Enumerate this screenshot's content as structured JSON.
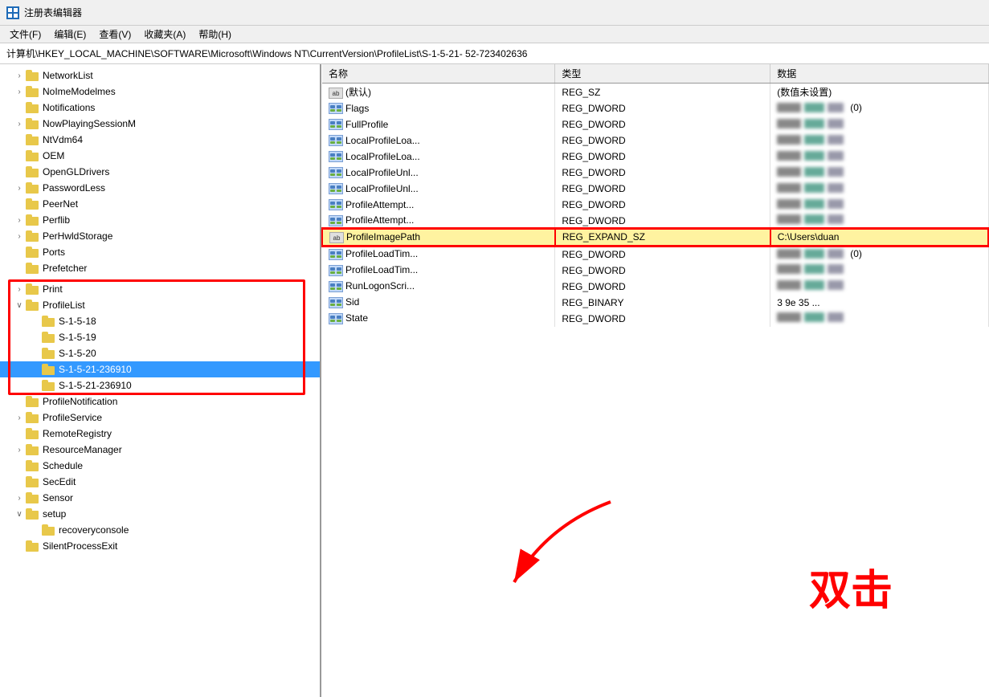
{
  "titlebar": {
    "icon": "🖥",
    "title": "注册表编辑器"
  },
  "menubar": {
    "items": [
      "文件(F)",
      "编辑(E)",
      "查看(V)",
      "收藏夹(A)",
      "帮助(H)"
    ]
  },
  "addressbar": {
    "path": "计算机\\HKEY_LOCAL_MACHINE\\SOFTWARE\\Microsoft\\Windows NT\\CurrentVersion\\ProfileList\\S-1-5-21-                52-723402636"
  },
  "tree": {
    "items": [
      {
        "label": "NetworkList",
        "indent": 1,
        "arrow": "›",
        "selected": false
      },
      {
        "label": "NoImeModelmes",
        "indent": 1,
        "arrow": "›",
        "selected": false
      },
      {
        "label": "Notifications",
        "indent": 1,
        "arrow": "",
        "selected": false
      },
      {
        "label": "NowPlayingSessionM",
        "indent": 1,
        "arrow": "›",
        "selected": false
      },
      {
        "label": "NtVdm64",
        "indent": 1,
        "arrow": "",
        "selected": false
      },
      {
        "label": "OEM",
        "indent": 1,
        "arrow": "",
        "selected": false
      },
      {
        "label": "OpenGLDrivers",
        "indent": 1,
        "arrow": "",
        "selected": false
      },
      {
        "label": "PasswordLess",
        "indent": 1,
        "arrow": "›",
        "selected": false
      },
      {
        "label": "PeerNet",
        "indent": 1,
        "arrow": "",
        "selected": false
      },
      {
        "label": "Perflib",
        "indent": 1,
        "arrow": "›",
        "selected": false
      },
      {
        "label": "PerHwldStorage",
        "indent": 1,
        "arrow": "›",
        "selected": false
      },
      {
        "label": "Ports",
        "indent": 1,
        "arrow": "",
        "selected": false
      },
      {
        "label": "Prefetcher",
        "indent": 1,
        "arrow": "",
        "selected": false
      },
      {
        "label": "Print",
        "indent": 1,
        "arrow": "›",
        "selected": false,
        "extra_space": true
      },
      {
        "label": "ProfileList",
        "indent": 1,
        "arrow": "∨",
        "selected": false,
        "highlighted": true
      },
      {
        "label": "S-1-5-18",
        "indent": 2,
        "arrow": "",
        "selected": false
      },
      {
        "label": "S-1-5-19",
        "indent": 2,
        "arrow": "",
        "selected": false
      },
      {
        "label": "S-1-5-20",
        "indent": 2,
        "arrow": "",
        "selected": false
      },
      {
        "label": "S-1-5-21-236910",
        "indent": 2,
        "arrow": "",
        "selected": true
      },
      {
        "label": "S-1-5-21-236910",
        "indent": 2,
        "arrow": "",
        "selected": false
      },
      {
        "label": "ProfileNotification",
        "indent": 1,
        "arrow": "",
        "selected": false
      },
      {
        "label": "ProfileService",
        "indent": 1,
        "arrow": "›",
        "selected": false
      },
      {
        "label": "RemoteRegistry",
        "indent": 1,
        "arrow": "",
        "selected": false
      },
      {
        "label": "ResourceManager",
        "indent": 1,
        "arrow": "›",
        "selected": false
      },
      {
        "label": "Schedule",
        "indent": 1,
        "arrow": "",
        "selected": false
      },
      {
        "label": "SecEdit",
        "indent": 1,
        "arrow": "",
        "selected": false
      },
      {
        "label": "Sensor",
        "indent": 1,
        "arrow": "›",
        "selected": false
      },
      {
        "label": "setup",
        "indent": 1,
        "arrow": "∨",
        "selected": false
      },
      {
        "label": "recoveryconsole",
        "indent": 2,
        "arrow": "",
        "selected": false
      },
      {
        "label": "SilentProcessExit",
        "indent": 1,
        "arrow": "",
        "selected": false
      }
    ]
  },
  "values": {
    "columns": [
      "名称",
      "类型",
      "数据"
    ],
    "rows": [
      {
        "name": "(默认)",
        "type_ab": true,
        "type": "REG_SZ",
        "data": "(数值未设置)",
        "blurred": false
      },
      {
        "name": "Flags",
        "type_ab": false,
        "type": "REG_DWORD",
        "data": "blurred_0",
        "blurred": true
      },
      {
        "name": "FullProfile",
        "type_ab": false,
        "type": "REG_DWORD",
        "data": "blurred",
        "blurred": true
      },
      {
        "name": "LocalProfileLoa...",
        "type_ab": false,
        "type": "REG_DWORD",
        "data": "blurred",
        "blurred": true
      },
      {
        "name": "LocalProfileLoa...",
        "type_ab": false,
        "type": "REG_DWORD",
        "data": "blurred",
        "blurred": true
      },
      {
        "name": "LocalProfileUnl...",
        "type_ab": false,
        "type": "REG_DWORD",
        "data": "blurred",
        "blurred": true
      },
      {
        "name": "LocalProfileUnl...",
        "type_ab": false,
        "type": "REG_DWORD",
        "data": "blurred",
        "blurred": true
      },
      {
        "name": "ProfileAttempt...",
        "type_ab": false,
        "type": "REG_DWORD",
        "data": "blurred",
        "blurred": true
      },
      {
        "name": "ProfileAttempt...",
        "type_ab": false,
        "type": "REG_DWORD",
        "data": "blurred",
        "blurred": true
      },
      {
        "name": "ProfileImagePath",
        "type_ab": true,
        "type": "REG_EXPAND_SZ",
        "data": "C:\\Users\\duan",
        "blurred": false,
        "highlighted": true
      },
      {
        "name": "ProfileLoadTim...",
        "type_ab": false,
        "type": "REG_DWORD",
        "data": "blurred_0",
        "blurred": true
      },
      {
        "name": "ProfileLoadTim...",
        "type_ab": false,
        "type": "REG_DWORD",
        "data": "blurred",
        "blurred": true
      },
      {
        "name": "RunLogonScri...",
        "type_ab": false,
        "type": "REG_DWORD",
        "data": "blurred",
        "blurred": true
      },
      {
        "name": "Sid",
        "type_ab": false,
        "type": "REG_BINARY",
        "data": "3 9e 35 ...",
        "blurred": false
      },
      {
        "name": "State",
        "type_ab": false,
        "type": "REG_DWORD",
        "data": "blurred",
        "blurred": true
      }
    ]
  },
  "annotation": {
    "text": "双击"
  }
}
